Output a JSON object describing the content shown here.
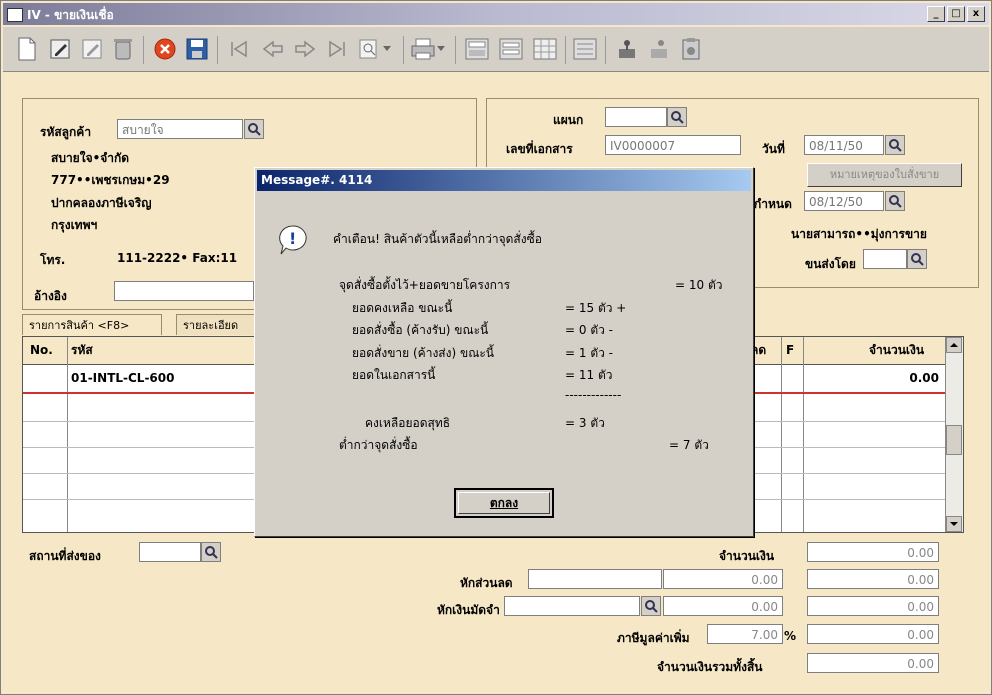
{
  "window": {
    "title": "IV - ขายเงินเชื่อ",
    "minimize": "_",
    "maximize": "□",
    "close": "x"
  },
  "customer": {
    "code_label": "รหัสลูกค้า",
    "code_value": "สบายใจ",
    "name": "สบายใจ•จำกัด",
    "address1": "777••เพชรเกษม•29",
    "address2": "ปากคลองภาษีเจริญ",
    "address3": "กรุงเทพฯ",
    "phone_label": "โทร.",
    "phone_value": "111-2222• Fax:11",
    "ref_label": "อ้างอิง"
  },
  "header": {
    "dept_label": "แผนก",
    "docno_label": "เลขที่เอกสาร",
    "docno_value": "IV0000007",
    "date_label": "วันที่",
    "date_value": "08/11/50",
    "note_button": "หมายเหตุของใบสั่งขาย",
    "due_label": "กำหนด",
    "due_value": "08/12/50",
    "salesman": "นายสามารถ••มุ่งการขาย",
    "ship_label": "ขนส่งโดย"
  },
  "tabs": [
    "รายการสินค้า <F8>",
    "รายละเอียด"
  ],
  "grid": {
    "col_no": "No.",
    "col_code": "รหัส",
    "col_disc": "ลด",
    "col_f": "F",
    "col_amount": "จำนวนเงิน",
    "row1_code": "01-INTL-CL-600",
    "row1_amount": "0.00"
  },
  "footer": {
    "ship_place_label": "สถานที่ส่งของ",
    "amount_label": "จำนวนเงิน",
    "amount_value": "0.00",
    "discount_label": "หักส่วนลด",
    "discount_value": "0.00",
    "discount_total": "0.00",
    "deposit_label": "หักเงินมัดจำ",
    "deposit_value": "0.00",
    "deposit_total": "0.00",
    "vat_label": "ภาษีมูลค่าเพิ่ม",
    "vat_rate": "7.00",
    "vat_pct": "%",
    "vat_total": "0.00",
    "grand_label": "จำนวนเงินรวมทั้งสิ้น",
    "grand_total": "0.00"
  },
  "dialog": {
    "title": "Message#. 4114",
    "warning": "คำเตือน! สินค้าตัวนี้เหลือต่ำกว่าจุดสั่งซื้อ",
    "l1": "จุดสั่งซื้อตั้งไว้+ยอดขายโครงการ",
    "l1v": "= 10 ตัว",
    "l2": "ยอดคงเหลือ ขณะนี้",
    "l2v": "= 15 ตัว +",
    "l3": "ยอดสั่งซื้อ (ค้างรับ) ขณะนี้",
    "l3v": "= 0 ตัว -",
    "l4": "ยอดสั่งขาย (ค้างส่ง) ขณะนี้",
    "l4v": "= 1 ตัว -",
    "l5": "ยอดในเอกสารนี้",
    "l5v": "= 11 ตัว",
    "divider": "-------------",
    "l6": "คงเหลือยอดสุทธิ",
    "l6v": "= 3 ตัว",
    "l7": "ต่ำกว่าจุดสั่งซื้อ",
    "l7v": "= 7 ตัว",
    "ok": "ตกลง"
  }
}
